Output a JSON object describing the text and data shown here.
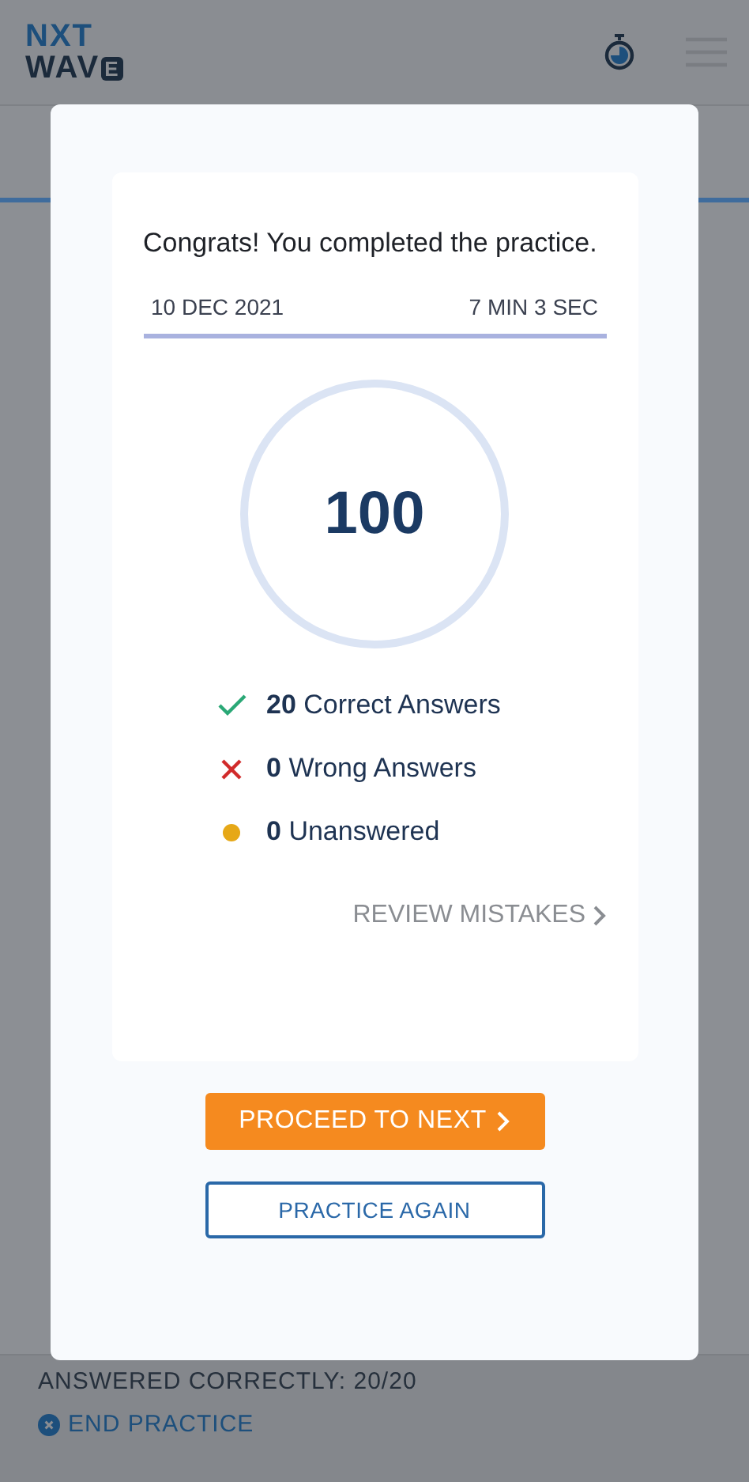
{
  "header": {
    "logo": {
      "line1": "NXT",
      "line2": "WAV",
      "boxed_letter": "E"
    }
  },
  "result": {
    "message": "Congrats! You completed the practice.",
    "date": "10 DEC 2021",
    "duration": "7 MIN 3 SEC",
    "score": "100",
    "stats": [
      {
        "kind": "correct",
        "count": "20",
        "label": "Correct Answers"
      },
      {
        "kind": "wrong",
        "count": "0",
        "label": "Wrong Answers"
      },
      {
        "kind": "unanswered",
        "count": "0",
        "label": "Unanswered"
      }
    ],
    "review_link": "REVIEW MISTAKES"
  },
  "buttons": {
    "proceed": "PROCEED TO NEXT",
    "again": "PRACTICE AGAIN"
  },
  "footer": {
    "answered": "ANSWERED CORRECTLY: 20/20",
    "end": "END PRACTICE"
  }
}
